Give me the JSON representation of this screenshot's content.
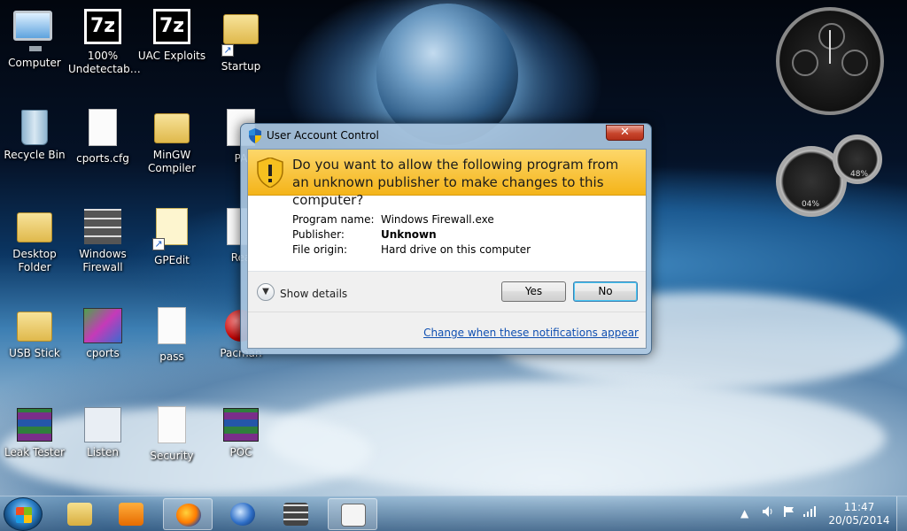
{
  "desktop": {
    "icons": [
      {
        "label": "Computer",
        "icon": "computer-icon"
      },
      {
        "label": "100%\nUndetectab…",
        "icon": "7zip-icon"
      },
      {
        "label": "UAC Exploits",
        "icon": "7zip-icon"
      },
      {
        "label": "Startup",
        "icon": "folder-icon"
      },
      {
        "label": "Recycle Bin",
        "icon": "recycle-bin-icon"
      },
      {
        "label": "cports.cfg",
        "icon": "file-icon"
      },
      {
        "label": "MinGW\nCompiler",
        "icon": "folder-icon"
      },
      {
        "label": "PA",
        "icon": "file-icon"
      },
      {
        "label": "Desktop\nFolder",
        "icon": "folder-icon"
      },
      {
        "label": "Windows\nFirewall",
        "icon": "firewall-icon"
      },
      {
        "label": "GPEdit",
        "icon": "notepad-icon"
      },
      {
        "label": "Rea",
        "icon": "file-icon"
      },
      {
        "label": "USB Stick",
        "icon": "folder-icon"
      },
      {
        "label": "cports",
        "icon": "cports-icon"
      },
      {
        "label": "pass",
        "icon": "file-icon"
      },
      {
        "label": "Pacman",
        "icon": "pacman-icon"
      },
      {
        "label": "Leak Tester",
        "icon": "winrar-icon"
      },
      {
        "label": "Listen",
        "icon": "listen-icon"
      },
      {
        "label": "Security",
        "icon": "file-icon"
      },
      {
        "label": "POC",
        "icon": "winrar-icon"
      }
    ]
  },
  "gadgets": {
    "cpu_left": "04%",
    "cpu_right": "48%"
  },
  "dialog": {
    "title": "User Account Control",
    "close_label": "✕",
    "question": "Do you want to allow the following program from an unknown publisher to make changes to this computer?",
    "program_name_label": "Program name:",
    "program_name_value": "Windows Firewall.exe",
    "publisher_label": "Publisher:",
    "publisher_value": "Unknown",
    "origin_label": "File origin:",
    "origin_value": "Hard drive on this computer",
    "show_details_label": "Show details",
    "yes_label": "Yes",
    "no_label": "No",
    "change_link": "Change when these notifications appear"
  },
  "taskbar": {
    "time": "11:47",
    "date": "20/05/2014",
    "tray_chevron": "▲"
  },
  "colors": {
    "banner": "#f4b419",
    "link": "#0f4fb1"
  }
}
